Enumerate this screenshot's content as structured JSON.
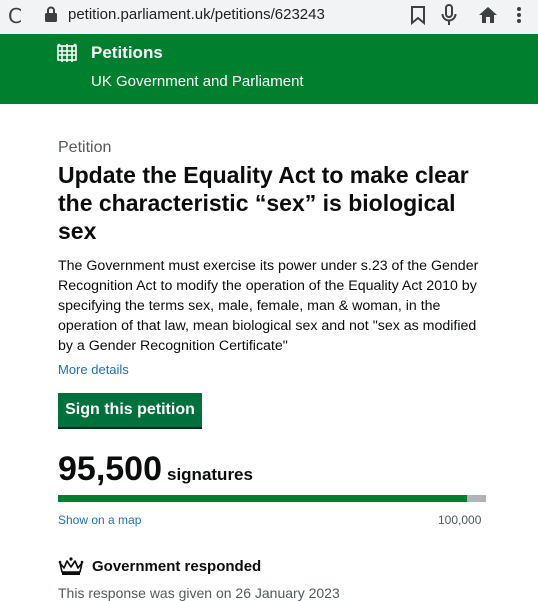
{
  "browser": {
    "url": "petition.parliament.uk/petitions/623243",
    "icons": [
      "reload-icon",
      "lock-icon",
      "bookmark-icon",
      "microphone-icon",
      "home-icon",
      "more-icon"
    ]
  },
  "header": {
    "brand": "Petitions",
    "subtitle": "UK Government and Parliament",
    "background": "#00802f"
  },
  "petition": {
    "caption": "Petition",
    "title": "Update the Equality Act to make clear the characteristic “sex” is biological sex",
    "description": "The Government must exercise its power under s.23 of the Gender Recognition Act to modify the operation of the Equality Act 2010 by specifying the terms sex, male, female, man & woman, in the operation of that law, mean biological sex and not \"sex as modified by a Gender Recognition Certificate\"",
    "more_details": "More details",
    "sign_label": "Sign this petition"
  },
  "signatures": {
    "count": "95,500",
    "label": "signatures",
    "count_value": 95500,
    "target_value": 100000,
    "progress_fraction": 0.955,
    "map_link": "Show on a map",
    "target": "100,000"
  },
  "government": {
    "title": "Government responded",
    "date_text": "This response was given on 26 January 2023"
  }
}
